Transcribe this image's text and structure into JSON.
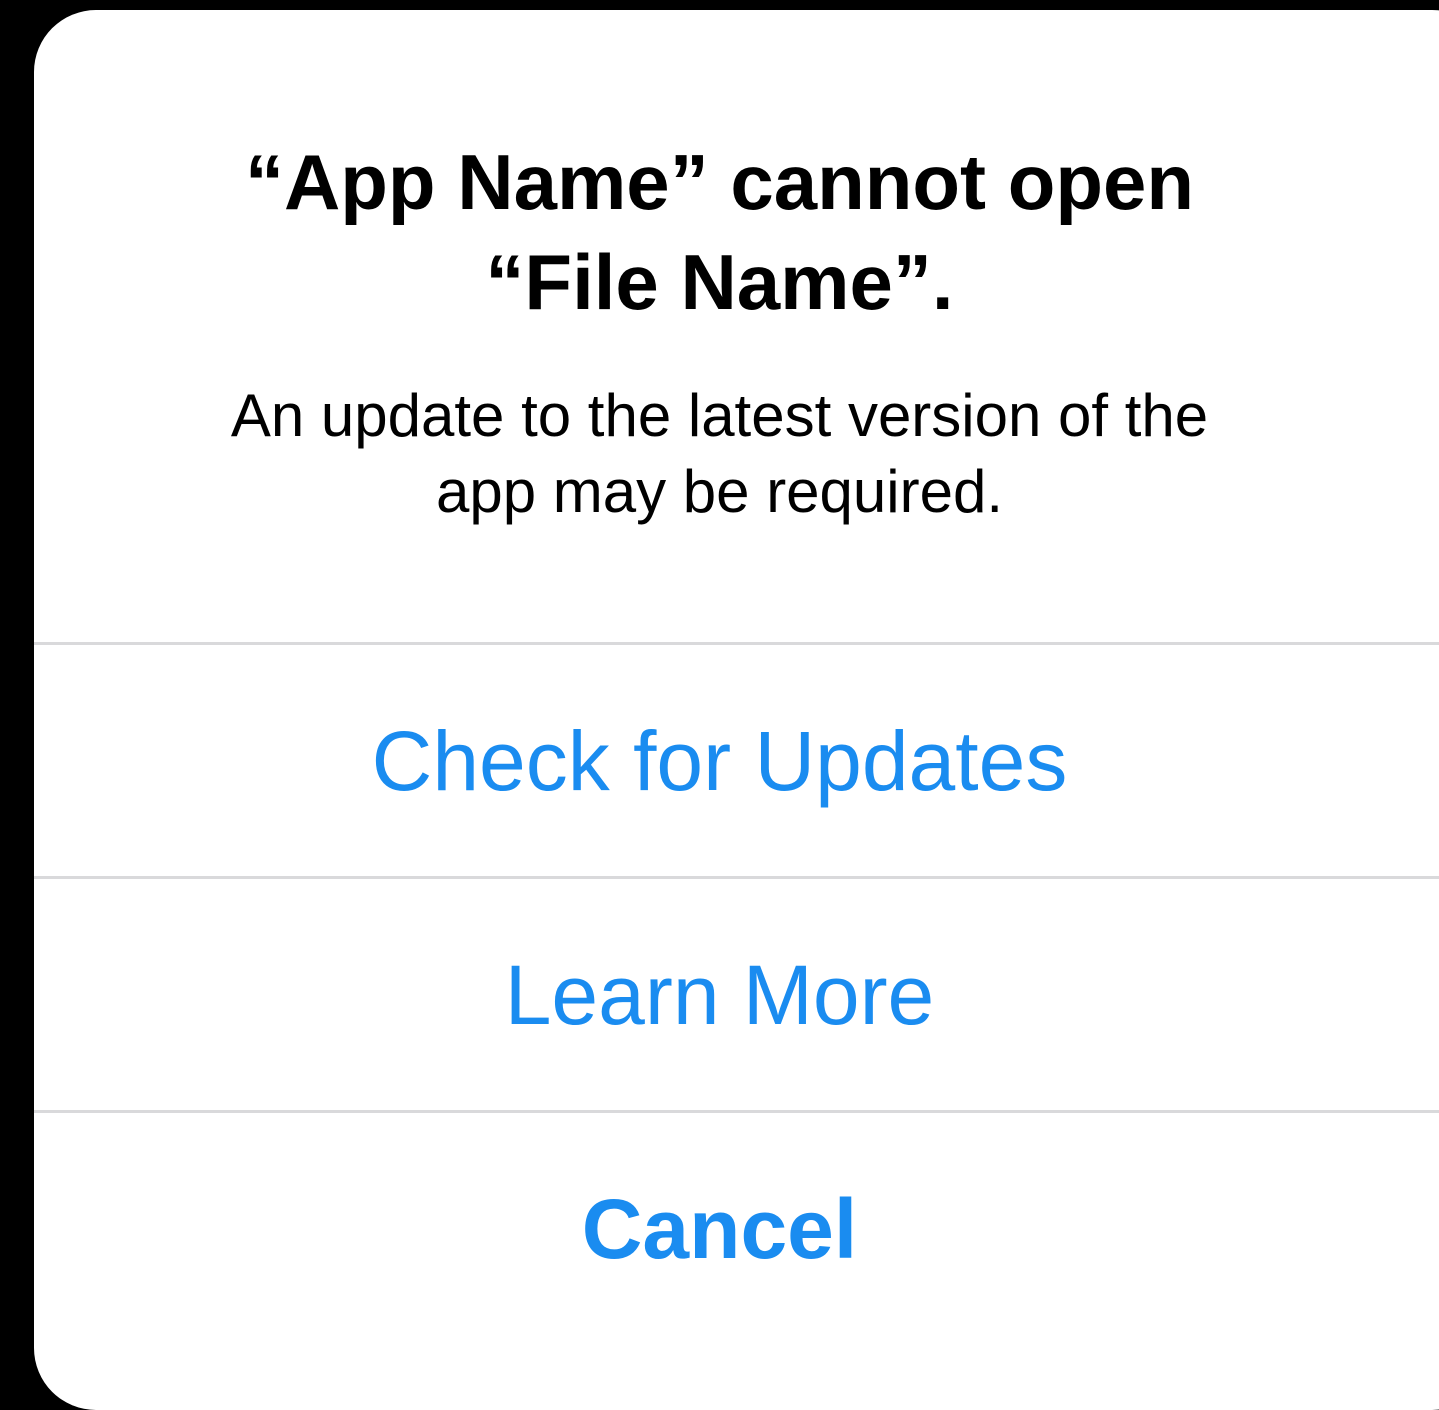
{
  "alert": {
    "title_line1": "“App Name” cannot open",
    "title_line2": "“File Name”.",
    "message_line1": "An update to the latest version of the",
    "message_line2": "app may be required.",
    "actions": [
      {
        "label": "Check for Updates"
      },
      {
        "label": "Learn More"
      },
      {
        "label": "Cancel"
      }
    ]
  },
  "colors": {
    "background": "#000000",
    "surface": "#ffffff",
    "title_text": "#000000",
    "action_text": "#1a8cf0",
    "divider": "#d9d9db"
  }
}
